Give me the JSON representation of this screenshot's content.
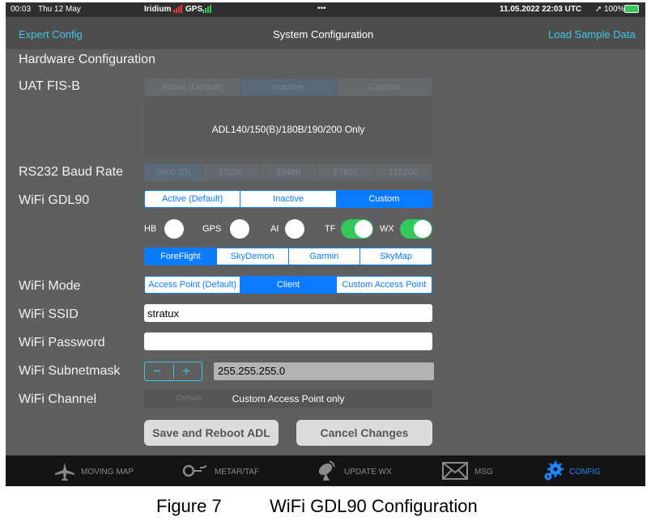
{
  "status_bar": {
    "time": "00:03",
    "date": "Thu 12 May",
    "iridium": "Iridium",
    "gps": "GPS",
    "dots": "•••",
    "datetime": "11.05.2022  22:03 UTC",
    "battery": "100%",
    "iridium_color": "#e53935",
    "gps_color": "#34c759"
  },
  "nav": {
    "left": "Expert Config",
    "title": "System Configuration",
    "right": "Load Sample Data"
  },
  "section_title": "Hardware Configuration",
  "uat": {
    "label": "UAT FIS-B",
    "options": [
      "Active (Default)",
      "Inactive",
      "Custom"
    ],
    "selected": "Inactive",
    "note": "ADL140/150(B)/180B/190/200 Only"
  },
  "baud": {
    "label": "RS232 Baud Rate",
    "options": [
      "9600 (D)",
      "19200",
      "38400",
      "57600",
      "115200"
    ],
    "selected": "9600 (D)"
  },
  "gdl90": {
    "label": "WiFi GDL90",
    "options": [
      "Active (Default)",
      "Inactive",
      "Custom"
    ],
    "selected": "Custom",
    "toggles": [
      {
        "label": "HB",
        "on": false
      },
      {
        "label": "GPS",
        "on": false
      },
      {
        "label": "AI",
        "on": false
      },
      {
        "label": "TF",
        "on": true
      },
      {
        "label": "WX",
        "on": true
      }
    ],
    "apps": [
      "ForeFlight",
      "SkyDemon",
      "Garmin",
      "SkyMap"
    ],
    "app_selected": "ForeFlight"
  },
  "wifi_mode": {
    "label": "WiFi Mode",
    "options": [
      "Access Point (Default)",
      "Client",
      "Custom Access Point"
    ],
    "selected": "Client"
  },
  "ssid": {
    "label": "WiFi SSID",
    "value": "stratux"
  },
  "password": {
    "label": "WiFi Password",
    "value": ""
  },
  "subnet": {
    "label": "WiFi Subnetmask",
    "minus": "−",
    "plus": "+",
    "value": "255.255.255.0"
  },
  "channel": {
    "label": "WiFi Channel",
    "default": "Default",
    "note": "Custom Access Point only"
  },
  "buttons": {
    "save": "Save and Reboot ADL",
    "cancel": "Cancel Changes"
  },
  "tabs": [
    {
      "label": "MOVING MAP",
      "icon": "airplane-icon"
    },
    {
      "label": "METAR/TAF",
      "icon": "windsock-icon"
    },
    {
      "label": "UPDATE WX",
      "icon": "satellite-icon"
    },
    {
      "label": "MSG",
      "icon": "envelope-icon"
    },
    {
      "label": "CONFIG",
      "icon": "gears-icon",
      "active": true
    }
  ],
  "caption": {
    "figure": "Figure 7",
    "title": "WiFi GDL90 Configuration"
  },
  "colors": {
    "accent": "#0a7bff",
    "cyan": "#3ec5e6",
    "switch_on": "#34c759",
    "active_tab": "#1e88ff"
  }
}
